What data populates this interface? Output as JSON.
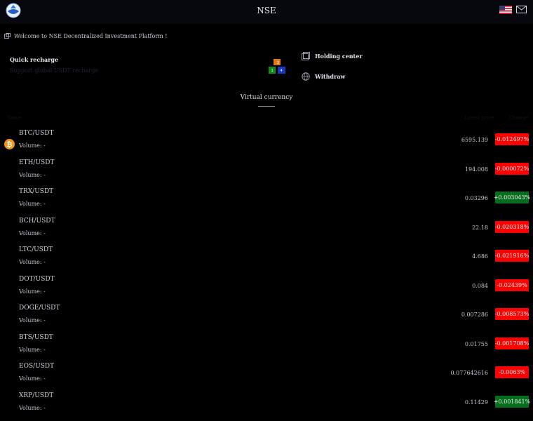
{
  "header": {
    "title": "NSE"
  },
  "welcome": {
    "text": "Welcome to NSE Decentralized Investment Platform !"
  },
  "quick_recharge": {
    "title": "Quick recharge",
    "subtitle": "Support global USDT recharge"
  },
  "menu": [
    {
      "label": "Holding center",
      "icon": "holding-center-icon"
    },
    {
      "label": "Withdraw",
      "icon": "globe-icon"
    }
  ],
  "tabs": {
    "active": "Virtual currency"
  },
  "table": {
    "headers": {
      "name": "Name",
      "price": "Latest price",
      "change": "Change"
    }
  },
  "colors": {
    "down": "#ff0000",
    "up": "#046e1c",
    "background": "#000000"
  },
  "markets": [
    {
      "pair": "BTC/USDT",
      "volume": "Volume: -",
      "price": "6595.139",
      "change": "-0.012497%",
      "direction": "down"
    },
    {
      "pair": "ETH/USDT",
      "volume": "Volume: -",
      "price": "194.008",
      "change": "-0.000072%",
      "direction": "down"
    },
    {
      "pair": "TRX/USDT",
      "volume": "Volume: -",
      "price": "0.03296",
      "change": "+0.003043%",
      "direction": "up"
    },
    {
      "pair": "BCH/USDT",
      "volume": "Volume: -",
      "price": "22.18",
      "change": "-0.020318%",
      "direction": "down"
    },
    {
      "pair": "LTC/USDT",
      "volume": "Volume: -",
      "price": "4.686",
      "change": "-0.021916%",
      "direction": "down"
    },
    {
      "pair": "DOT/USDT",
      "volume": "Volume: -",
      "price": "0.084",
      "change": "-0.02439%",
      "direction": "down"
    },
    {
      "pair": "DOGE/USDT",
      "volume": "Volume: -",
      "price": "0.007286",
      "change": "-0.008573%",
      "direction": "down"
    },
    {
      "pair": "BTS/USDT",
      "volume": "Volume: -",
      "price": "0.01755",
      "change": "-0.001708%",
      "direction": "down"
    },
    {
      "pair": "EOS/USDT",
      "volume": "Volume: -",
      "price": "0.077642616",
      "change": "-0.0063%",
      "direction": "down"
    },
    {
      "pair": "XRP/USDT",
      "volume": "Volume: -",
      "price": "0.11429",
      "change": "+0.001841%",
      "direction": "up"
    }
  ]
}
